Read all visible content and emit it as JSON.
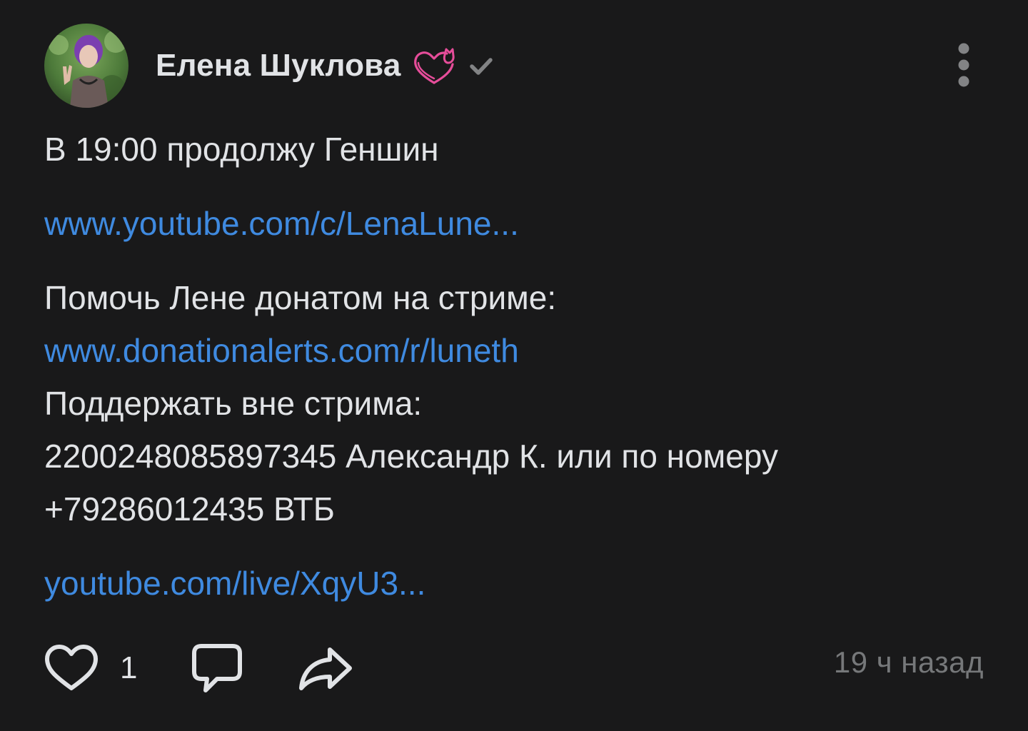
{
  "author": {
    "name": "Елена Шуклова",
    "badge": "cat-heart-icon",
    "verified": "checkmark-icon"
  },
  "post": {
    "line1": "В 19:00 продолжу Геншин",
    "link1": "www.youtube.com/c/LenaLune...",
    "line2": "Помочь Лене донатом на стриме:",
    "link2": "www.donationalerts.com/r/luneth",
    "line3": "Поддержать вне стрима:",
    "line4": "2200248085897345 Александр К. или по номеру",
    "line5": "+79286012435 ВТБ",
    "link3": "youtube.com/live/XqyU3..."
  },
  "footer": {
    "like_count": "1",
    "timestamp": "19 ч назад"
  },
  "colors": {
    "background": "#19191a",
    "text": "#e1e3e6",
    "link": "#3f8ae0",
    "secondary": "#76787a",
    "badge": "#e64d9a"
  }
}
